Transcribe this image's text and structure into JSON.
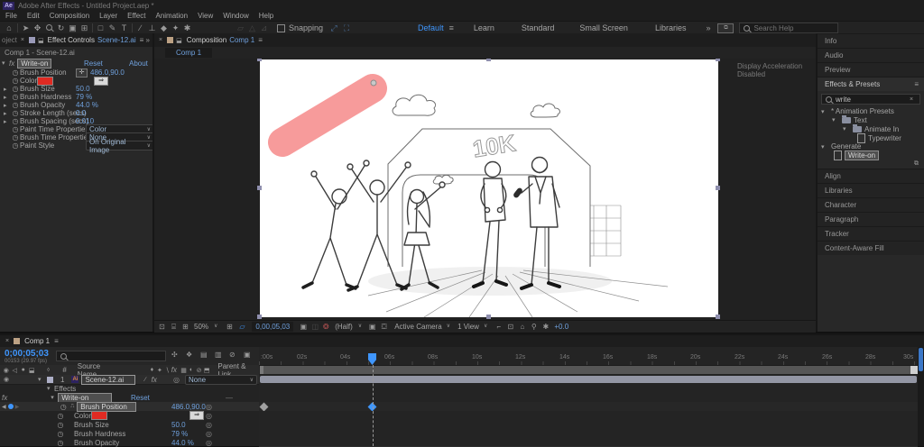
{
  "colors": {
    "accent_blue": "#3f96fd",
    "value_blue": "#6fa0dc",
    "swatch_red": "#e02a22",
    "swatch_style": "background:#e02a22",
    "brush_stroke_pink": "#f79b9b"
  },
  "titlebar": {
    "app_badge": "Ae",
    "title": "Adobe After Effects - Untitled Project.aep *"
  },
  "menubar": {
    "items": [
      "File",
      "Edit",
      "Composition",
      "Layer",
      "Effect",
      "Animation",
      "View",
      "Window",
      "Help"
    ]
  },
  "toolbar": {
    "snapping_label": "Snapping",
    "workspaces": [
      "Default",
      "Learn",
      "Standard",
      "Small Screen",
      "Libraries"
    ],
    "search_placeholder": "Search Help"
  },
  "effect_controls": {
    "project_tab_partial": "oject",
    "tab_title": "Effect Controls",
    "tab_target": "Scene-12.ai",
    "breadcrumb": "Comp 1 - Scene-12.ai",
    "effect_name": "Write-on",
    "reset_label": "Reset",
    "about_label": "About",
    "properties": [
      {
        "label": "Brush Position",
        "value": "486.0,90.0"
      },
      {
        "label": "Color",
        "value": ""
      },
      {
        "label": "Brush Size",
        "value": "50.0"
      },
      {
        "label": "Brush Hardness",
        "value": "79 %"
      },
      {
        "label": "Brush Opacity",
        "value": "44.0 %"
      },
      {
        "label": "Stroke Length (secs)",
        "value": "0.0"
      },
      {
        "label": "Brush Spacing (secs)",
        "value": "0.010"
      },
      {
        "label": "Paint Time Properties",
        "value": "Color"
      },
      {
        "label": "Brush Time Properties",
        "value": "None"
      },
      {
        "label": "Paint Style",
        "value": "On Original Image"
      }
    ]
  },
  "composition": {
    "tab_title": "Composition",
    "tab_target": "Comp 1",
    "sub_tab": "Comp 1",
    "overlay_message": "Display Acceleration Disabled",
    "canvas_text_10k": "10K",
    "bottom_bar": {
      "zoom": "50%",
      "timecode": "0,00,05,03",
      "resolution": "(Half)",
      "camera": "Active Camera",
      "view": "1 View",
      "exposure": "+0.0"
    }
  },
  "sidebar": {
    "panels_top": [
      "Info",
      "Audio",
      "Preview"
    ],
    "effects_presets": {
      "title": "Effects & Presets",
      "search_value": "write",
      "tree": [
        {
          "label": "* Animation Presets"
        },
        {
          "label": "Text"
        },
        {
          "label": "Animate In"
        },
        {
          "label": "Typewriter"
        },
        {
          "label": "Generate"
        },
        {
          "label": "Write-on"
        }
      ]
    },
    "panels_bottom": [
      "Align",
      "Libraries",
      "Character",
      "Paragraph",
      "Tracker",
      "Content-Aware Fill"
    ]
  },
  "timeline": {
    "tab_name": "Comp 1",
    "timecode": "0;00;05;03",
    "frame_info": "00153 (29.97 fps)",
    "columns": {
      "number": "#",
      "source": "Source Name",
      "parent": "Parent & Link"
    },
    "layer": {
      "number": "1",
      "name": "Scene-12.ai",
      "parent_value": "None"
    },
    "effects_group_label": "Effects",
    "effect_name": "Write-on",
    "reset_label": "Reset",
    "properties": [
      {
        "label": "Brush Position",
        "value": "486.0,90.0"
      },
      {
        "label": "Color",
        "value": ""
      },
      {
        "label": "Brush Size",
        "value": "50.0"
      },
      {
        "label": "Brush Hardness",
        "value": "79 %"
      },
      {
        "label": "Brush Opacity",
        "value": "44.0 %"
      }
    ],
    "ruler_ticks": [
      ":00s",
      "02s",
      "04s",
      "06s",
      "08s",
      "10s",
      "12s",
      "14s",
      "16s",
      "18s",
      "20s",
      "22s",
      "24s",
      "26s",
      "28s",
      "30s"
    ]
  }
}
